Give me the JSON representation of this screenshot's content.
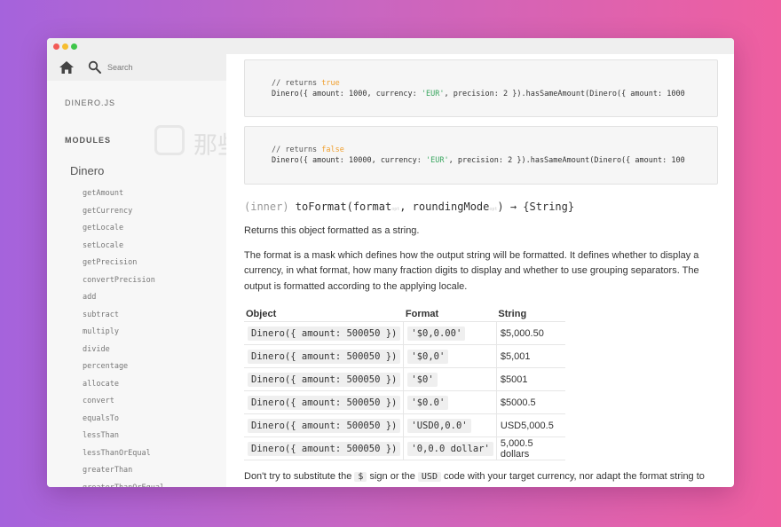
{
  "sidebar": {
    "search_placeholder": "Search",
    "brand": "DINERO.JS",
    "section_title": "MODULES",
    "module_name": "Dinero",
    "methods": [
      "getAmount",
      "getCurrency",
      "getLocale",
      "setLocale",
      "getPrecision",
      "convertPrecision",
      "add",
      "subtract",
      "multiply",
      "divide",
      "percentage",
      "allocate",
      "convert",
      "equalsTo",
      "lessThan",
      "lessThanOrEqual",
      "greaterThan",
      "greaterThanOrEqual"
    ]
  },
  "watermark": {
    "text": "那些免费的砖"
  },
  "code_blocks": [
    {
      "comment_prefix": "// returns ",
      "comment_value": "true",
      "code_a": "Dinero({ amount: 1000, currency: ",
      "code_str": "'EUR'",
      "code_b": ", precision: 2 }).hasSameAmount(Dinero({ amount: 1000"
    },
    {
      "comment_prefix": "// returns ",
      "comment_value": "false",
      "code_a": "Dinero({ amount: 10000, currency: ",
      "code_str": "'EUR'",
      "code_b": ", precision: 2 }).hasSameAmount(Dinero({ amount: 100"
    }
  ],
  "signature": {
    "scope": "(inner) ",
    "name": "toFormat",
    "open": "(",
    "param1": "format",
    "opt1": "opt",
    "sep": ", ",
    "param2": "roundingMode",
    "opt2": "opt",
    "close_return": ") → {String}"
  },
  "description": "Returns this object formatted as a string.",
  "paragraph": "The format is a mask which defines how the output string will be formatted. It defines whether to display a currency, in what format, how many fraction digits to display and whether to use grouping separators. The output is formatted according to the applying locale.",
  "table": {
    "headers": [
      "Object",
      "Format",
      "String"
    ],
    "rows": [
      [
        "Dinero({ amount: 500050 })",
        "'$0,0.00'",
        "$5,000.50"
      ],
      [
        "Dinero({ amount: 500050 })",
        "'$0,0'",
        "$5,001"
      ],
      [
        "Dinero({ amount: 500050 })",
        "'$0'",
        "$5001"
      ],
      [
        "Dinero({ amount: 500050 })",
        "'$0.0'",
        "$5000.5"
      ],
      [
        "Dinero({ amount: 500050 })",
        "'USD0,0.0'",
        "USD5,000.5"
      ],
      [
        "Dinero({ amount: 500050 })",
        "'0,0.0 dollar'",
        "5,000.5 dollars"
      ]
    ]
  },
  "footer_text": {
    "a": "Don't try to substitute the ",
    "code1": "$",
    "b": " sign or the ",
    "code2": "USD",
    "c": " code with your target currency, nor adapt the format string to"
  }
}
